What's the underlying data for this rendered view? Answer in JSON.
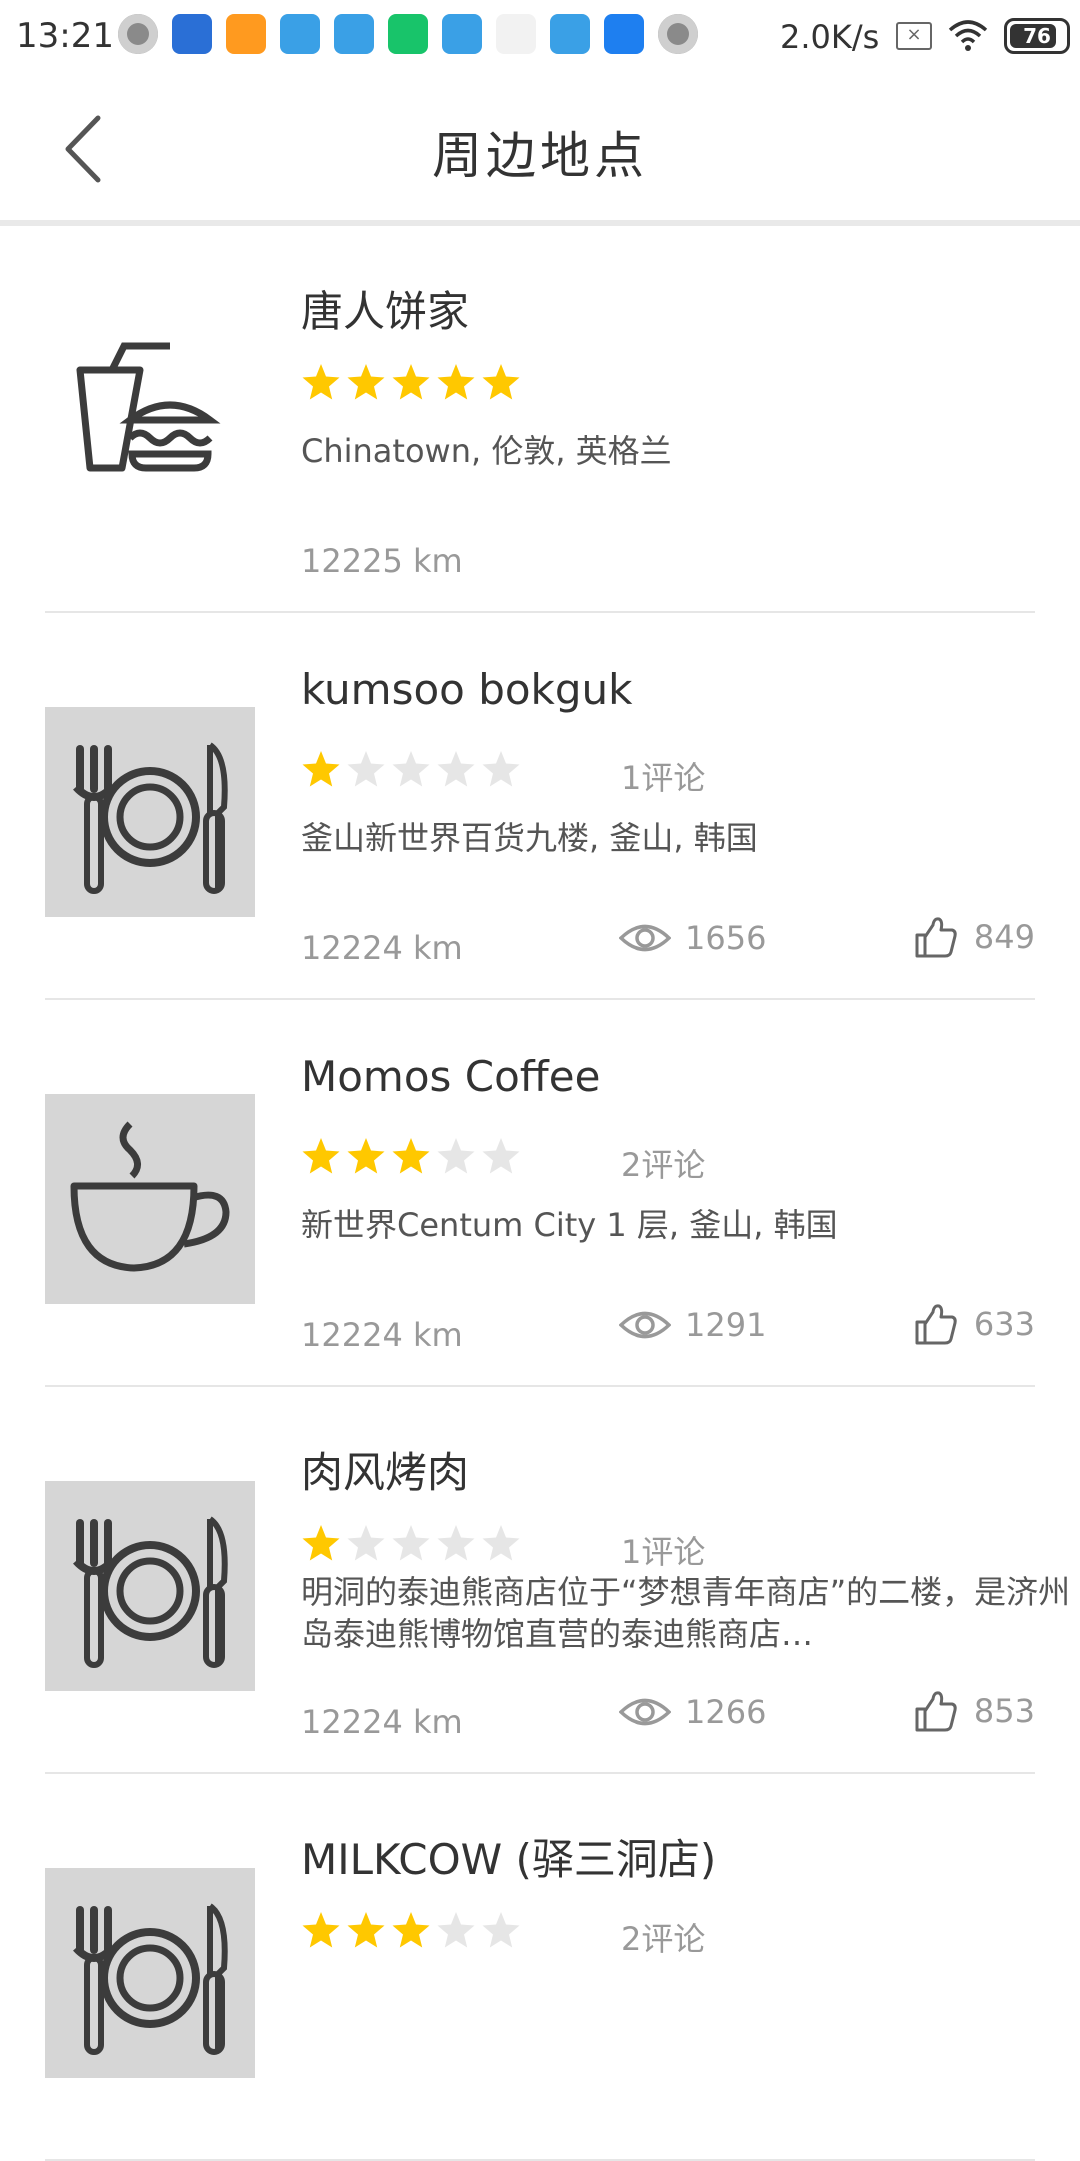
{
  "status_bar": {
    "time": "13:21",
    "network_speed": "2.0K/s",
    "battery": "76"
  },
  "header": {
    "title": "周边地点",
    "back_icon": "chevron-left-icon"
  },
  "colors": {
    "star_on": "#FFC800",
    "star_off": "#E6E6E6",
    "thumb_bg": "#D6D6D6"
  },
  "places": [
    {
      "name": "唐人饼家",
      "rating": 5,
      "reviews": "",
      "address": "Chinatown, 伦敦, 英格兰",
      "distance": "12225 km",
      "views": "",
      "likes": "",
      "icon": "fastfood-icon"
    },
    {
      "name": "kumsoo bokguk",
      "rating": 1,
      "reviews": "1评论",
      "address": "釜山新世界百货九楼, 釜山, 韩国",
      "distance": "12224 km",
      "views": "1656",
      "likes": "849",
      "icon": "restaurant-icon"
    },
    {
      "name": "Momos Coffee",
      "rating": 3,
      "reviews": "2评论",
      "address": "新世界Centum City 1 层, 釜山, 韩国",
      "distance": "12224 km",
      "views": "1291",
      "likes": "633",
      "icon": "coffee-icon"
    },
    {
      "name": "肉风烤肉",
      "rating": 1,
      "reviews": "1评论",
      "address": "明洞的泰迪熊商店位于“梦想青年商店”的二楼，是济州岛泰迪熊博物馆直营的泰迪熊商店…",
      "distance": "12224 km",
      "views": "1266",
      "likes": "853",
      "icon": "restaurant-icon"
    },
    {
      "name": "MILKCOW (驿三洞店)",
      "rating": 3,
      "reviews": "2评论",
      "address": "",
      "distance": "",
      "views": "",
      "likes": "",
      "icon": "restaurant-icon"
    }
  ]
}
